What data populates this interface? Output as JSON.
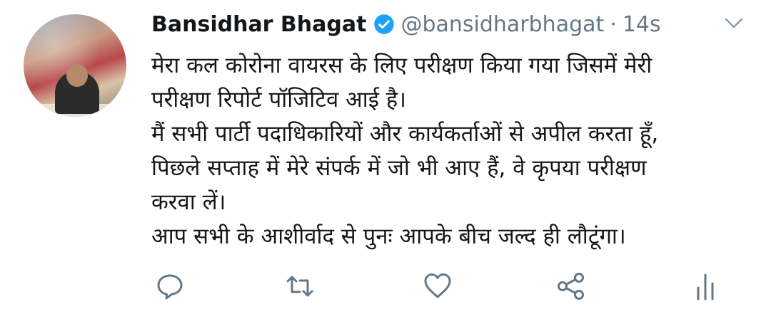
{
  "author": {
    "display_name": "Bansidhar Bhagat",
    "handle": "@bansidharbhagat",
    "separator": "·",
    "time": "14s"
  },
  "tweet": {
    "lines": [
      "मेरा कल कोरोना वायरस के लिए परीक्षण किया गया जिसमें मेरी",
      "परीक्षण रिपोर्ट पॉजिटिव आई है।",
      " मैं सभी पार्टी पदाधिकारियों और कार्यकर्ताओं से अपील करता हूँ,",
      "पिछले सप्ताह में मेरे संपर्क में जो भी आए हैं, वे कृपया परीक्षण",
      "करवा लें।",
      "आप सभी के आशीर्वाद से पुनः आपके बीच जल्द ही लौटूंगा।"
    ]
  },
  "icons": {
    "verified": "verified-badge-icon",
    "more": "chevron-down-icon",
    "reply": "reply-icon",
    "retweet": "retweet-icon",
    "like": "heart-icon",
    "share": "share-icon",
    "analytics": "analytics-icon"
  },
  "colors": {
    "text": "#14171a",
    "secondary": "#657786",
    "verified": "#1da1f2",
    "icon": "#657786"
  }
}
